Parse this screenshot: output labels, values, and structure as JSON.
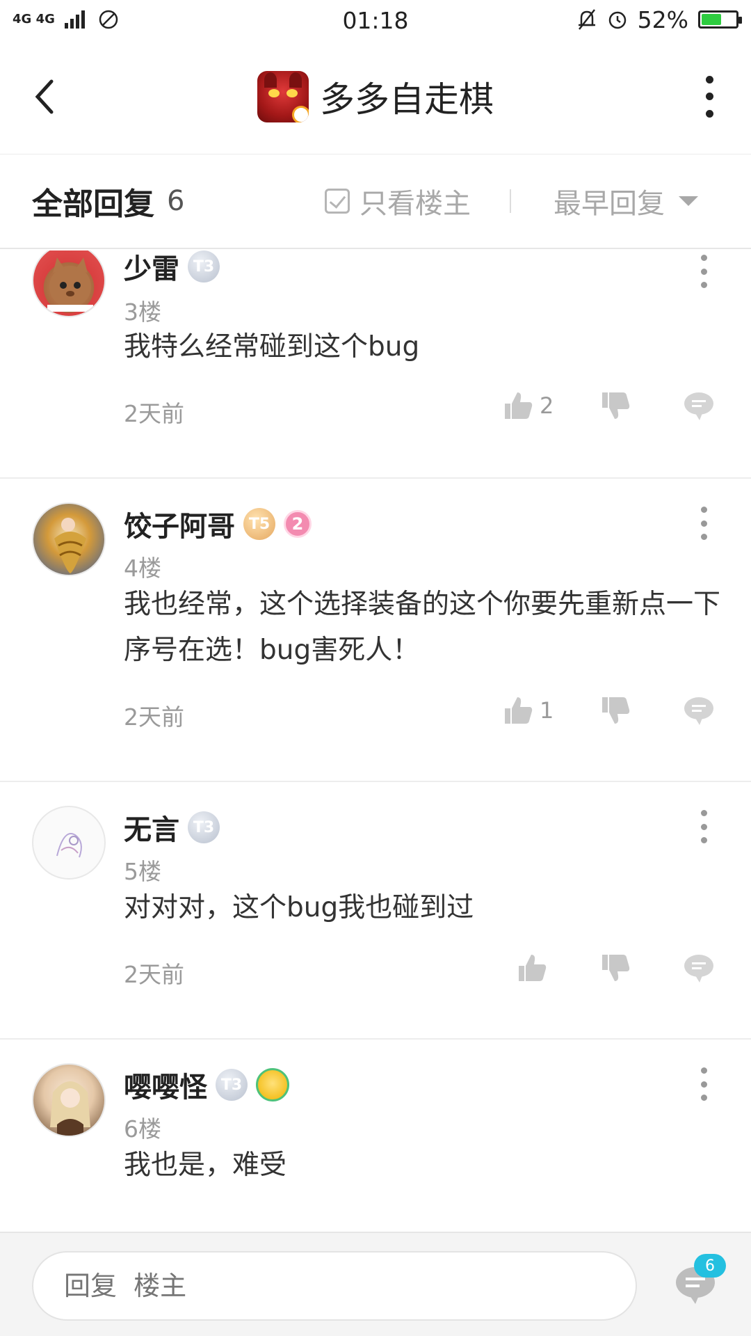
{
  "status_bar": {
    "network": "4G 4G",
    "time": "01:18",
    "battery": "52%",
    "battery_level": 0.52
  },
  "header": {
    "title": "多多自走棋"
  },
  "filter": {
    "title": "全部回复",
    "count": "6",
    "only_op": "只看楼主",
    "sort": "最早回复"
  },
  "replies": [
    {
      "name": "少雷",
      "badge": "T3",
      "floor": "3楼",
      "content": "我特么经常碰到这个bug",
      "time": "2天前",
      "likes": "2"
    },
    {
      "name": "饺子阿哥",
      "badge": "T5",
      "extra_badge": "2",
      "floor": "4楼",
      "content": "我也经常，这个选择装备的这个你要先重新点一下序号在选！bug害死人！",
      "time": "2天前",
      "likes": "1"
    },
    {
      "name": "无言",
      "badge": "T3",
      "floor": "5楼",
      "content": "对对对，这个bug我也碰到过",
      "time": "2天前",
      "likes": ""
    },
    {
      "name": "嘤嘤怪",
      "badge": "T3",
      "floor": "6楼",
      "content": "我也是，难受",
      "time": "",
      "likes": ""
    }
  ],
  "bottom": {
    "placeholder": "回复  楼主",
    "comment_count": "6"
  },
  "colors": {
    "accent": "#24c0e0",
    "battery_green": "#2ecc40"
  }
}
